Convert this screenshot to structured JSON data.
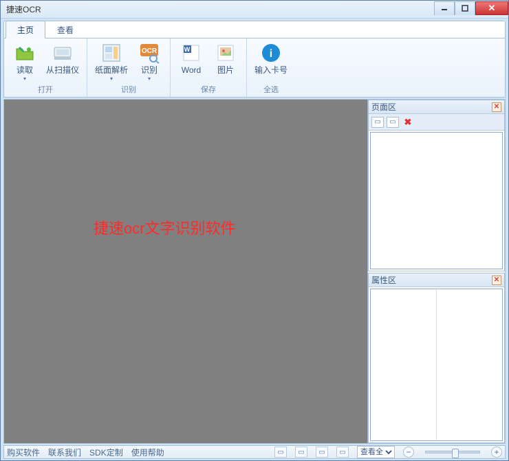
{
  "window": {
    "title": "捷速OCR"
  },
  "tabs": {
    "home": "主页",
    "view": "查看"
  },
  "ribbon": {
    "groups": {
      "open": {
        "label": "打开",
        "read": "读取",
        "scanner": "从扫描仪"
      },
      "recog": {
        "label": "识别",
        "parse": "纸面解析",
        "ocr": "识别"
      },
      "save": {
        "label": "保存",
        "word": "Word",
        "image": "图片"
      },
      "select": {
        "label": "全选",
        "card": "输入卡号"
      }
    }
  },
  "canvas": {
    "watermark": "捷速ocr文字识别软件"
  },
  "panels": {
    "pages": "页面区",
    "props": "属性区"
  },
  "status": {
    "buy": "购买软件",
    "contact": "联系我们",
    "sdk": "SDK定制",
    "help": "使用帮助",
    "zoom_mode": "查看全"
  }
}
